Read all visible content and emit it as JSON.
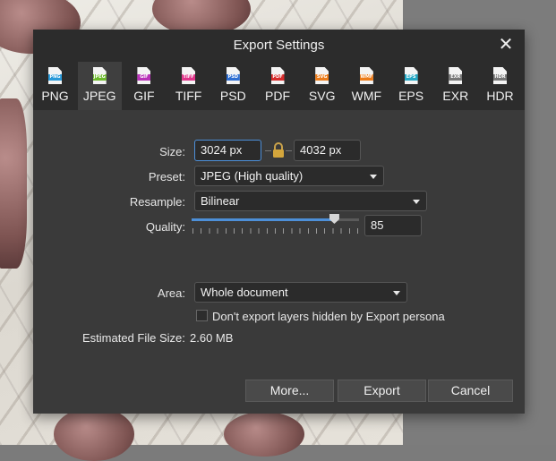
{
  "dialog": {
    "title": "Export Settings",
    "close_glyph": "✕"
  },
  "formats": [
    {
      "label": "PNG",
      "tag": "PNG",
      "color": "#2a9ad9"
    },
    {
      "label": "JPEG",
      "tag": "JPEG",
      "color": "#6dbb2c",
      "selected": true
    },
    {
      "label": "GIF",
      "tag": "GIF",
      "color": "#b833b8"
    },
    {
      "label": "TIFF",
      "tag": "TIFF",
      "color": "#e0358a"
    },
    {
      "label": "PSD",
      "tag": "PSD",
      "color": "#2f6fd2"
    },
    {
      "label": "PDF",
      "tag": "PDF",
      "color": "#d82c2c"
    },
    {
      "label": "SVG",
      "tag": "SVG",
      "color": "#ec7c1b"
    },
    {
      "label": "WMF",
      "tag": "WMF",
      "color": "#ec7c1b"
    },
    {
      "label": "EPS",
      "tag": "EPS",
      "color": "#26a8c4"
    },
    {
      "label": "EXR",
      "tag": "EXR",
      "color": "#777777"
    },
    {
      "label": "HDR",
      "tag": "HDR",
      "color": "#777777"
    }
  ],
  "settings": {
    "size_label": "Size:",
    "width": "3024 px",
    "height": "4032 px",
    "preset_label": "Preset:",
    "preset_value": "JPEG (High quality)",
    "resample_label": "Resample:",
    "resample_value": "Bilinear",
    "quality_label": "Quality:",
    "quality_value": "85",
    "quality_fraction": 0.85,
    "area_label": "Area:",
    "area_value": "Whole document",
    "hidden_layers_label": "Don't export layers hidden by Export persona",
    "hidden_layers_checked": false,
    "file_size_label": "Estimated File Size:",
    "file_size_value": "2.60 MB"
  },
  "buttons": {
    "more": "More...",
    "export": "Export",
    "cancel": "Cancel"
  },
  "icons": {
    "lock": "lock-icon"
  },
  "colors": {
    "accent": "#4d8fd8",
    "dialog_bg": "#3a3a3a",
    "titlebar_bg": "#2c2c2c"
  }
}
